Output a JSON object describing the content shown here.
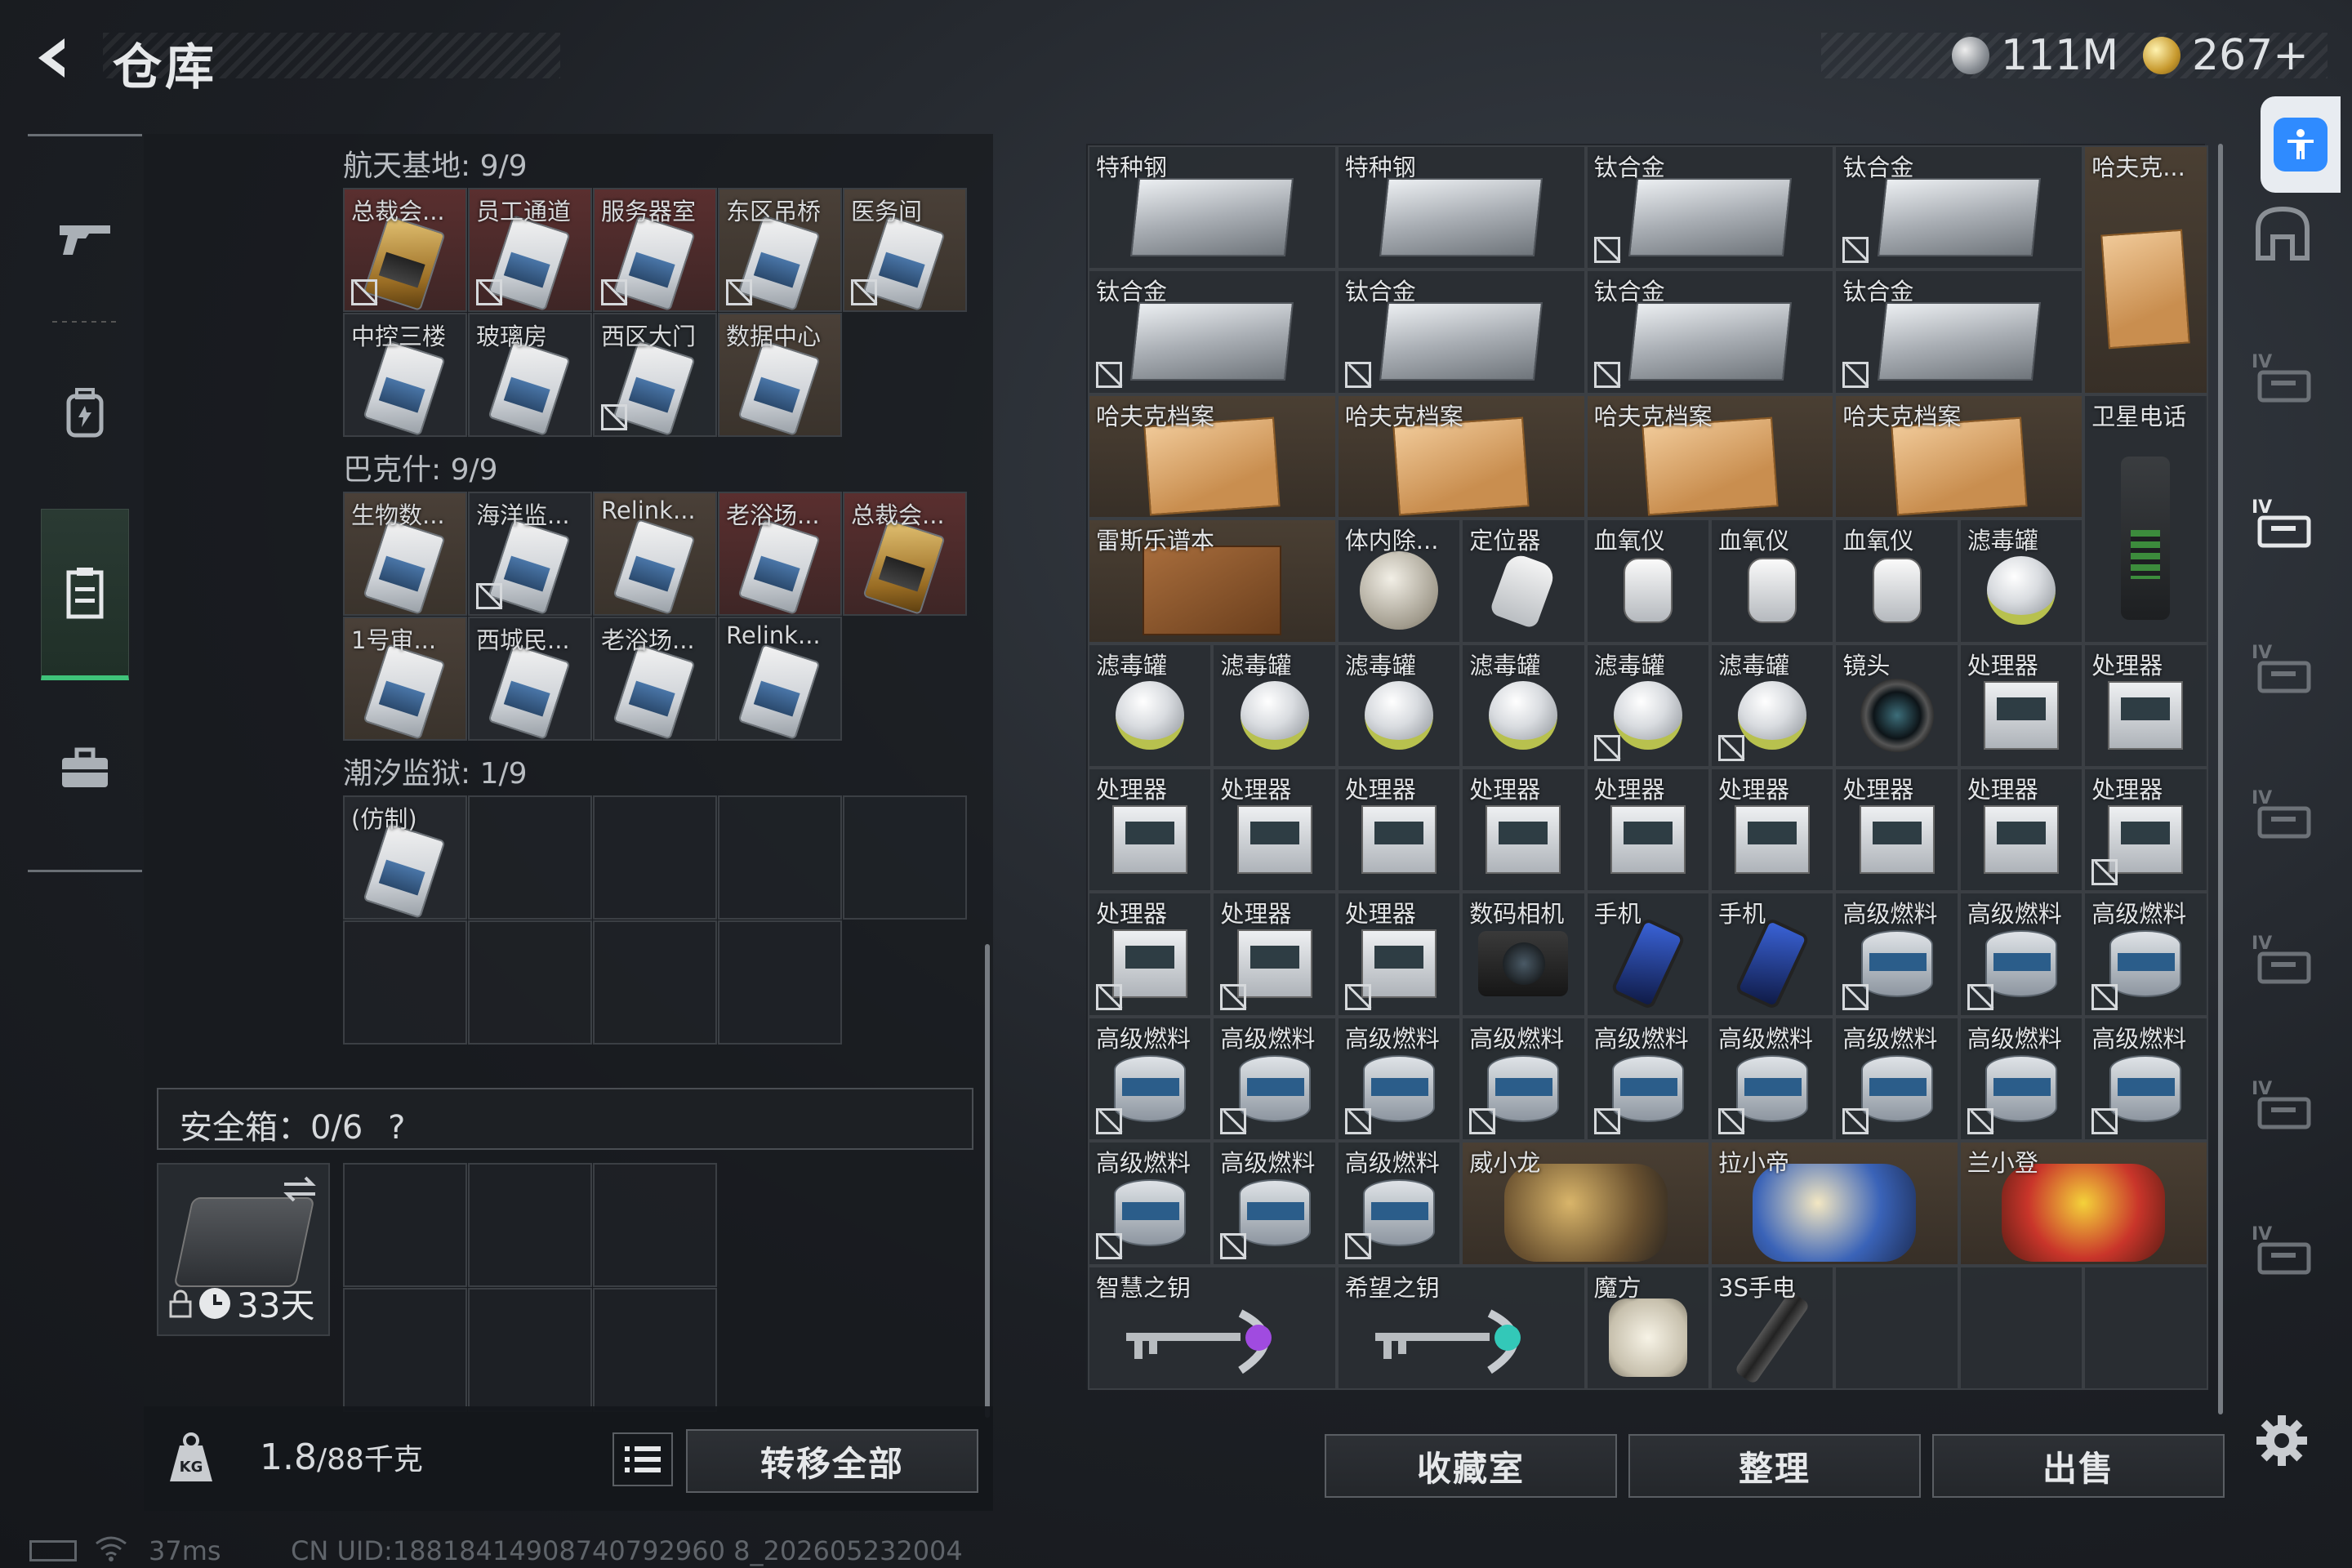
{
  "header": {
    "title": "仓库",
    "currency": [
      {
        "icon": "silver-coin-icon",
        "value": "111M"
      },
      {
        "icon": "gold-coin-icon",
        "value": "267+"
      }
    ]
  },
  "left_nav": [
    "gun-icon",
    "backpack-icon",
    "storage-icon",
    "briefcase-icon"
  ],
  "stash": {
    "sections": [
      {
        "label": "航天基地: 9/9",
        "items": [
          {
            "name": "总裁会...",
            "style": "gold",
            "bg": "red",
            "nolock": true
          },
          {
            "name": "员工通道",
            "style": "white",
            "bg": "red",
            "nolock": true
          },
          {
            "name": "服务器室",
            "style": "white",
            "bg": "red",
            "nolock": true
          },
          {
            "name": "东区吊桥",
            "style": "white",
            "bg": "brown",
            "nolock": true
          },
          {
            "name": "医务间",
            "style": "white",
            "bg": "brown",
            "nolock": true
          },
          {
            "name": "中控三楼",
            "style": "white",
            "bg": "grey",
            "nolock": false
          },
          {
            "name": "玻璃房",
            "style": "white",
            "bg": "grey",
            "nolock": false
          },
          {
            "name": "西区大门",
            "style": "white",
            "bg": "grey",
            "nolock": true
          },
          {
            "name": "数据中心",
            "style": "white",
            "bg": "brown",
            "nolock": false
          }
        ]
      },
      {
        "label": "巴克什: 9/9",
        "items": [
          {
            "name": "生物数...",
            "style": "white",
            "bg": "brown",
            "nolock": false
          },
          {
            "name": "海洋监...",
            "style": "white",
            "bg": "grey",
            "nolock": true
          },
          {
            "name": "Relink...",
            "style": "white",
            "bg": "brown",
            "nolock": false
          },
          {
            "name": "老浴场...",
            "style": "white",
            "bg": "red",
            "nolock": false
          },
          {
            "name": "总裁会...",
            "style": "gold",
            "bg": "red",
            "nolock": false
          },
          {
            "name": "1号审...",
            "style": "white",
            "bg": "brown",
            "nolock": false
          },
          {
            "name": "西城民...",
            "style": "white",
            "bg": "grey",
            "nolock": false
          },
          {
            "name": "老浴场...",
            "style": "white",
            "bg": "grey",
            "nolock": false
          },
          {
            "name": "Relink...",
            "style": "white",
            "bg": "grey",
            "nolock": false
          }
        ]
      },
      {
        "label": "潮汐监狱: 1/9",
        "items": [
          {
            "name": "(仿制)",
            "style": "white",
            "bg": "grey",
            "nolock": false
          }
        ]
      }
    ],
    "safe_box": {
      "label": "安全箱：0/6",
      "help": "?"
    },
    "case_timer": "33天",
    "weight": {
      "current": "1.8",
      "max": "/88千克"
    },
    "transfer_all": "转移全部"
  },
  "inventory": {
    "items": [
      {
        "name": "特种钢",
        "art": "plate",
        "c": 0,
        "r": 0,
        "w": 2,
        "h": 1,
        "nolock": false
      },
      {
        "name": "特种钢",
        "art": "plate",
        "c": 2,
        "r": 0,
        "w": 2,
        "h": 1,
        "nolock": false
      },
      {
        "name": "钛合金",
        "art": "plate",
        "c": 4,
        "r": 0,
        "w": 2,
        "h": 1,
        "nolock": true
      },
      {
        "name": "钛合金",
        "art": "plate",
        "c": 6,
        "r": 0,
        "w": 2,
        "h": 1,
        "nolock": true
      },
      {
        "name": "哈夫克...",
        "art": "folder-tall",
        "c": 8,
        "r": 0,
        "w": 1,
        "h": 2,
        "nolock": false
      },
      {
        "name": "钛合金",
        "art": "plate",
        "c": 0,
        "r": 1,
        "w": 2,
        "h": 1,
        "nolock": true
      },
      {
        "name": "钛合金",
        "art": "plate",
        "c": 2,
        "r": 1,
        "w": 2,
        "h": 1,
        "nolock": true
      },
      {
        "name": "钛合金",
        "art": "plate",
        "c": 4,
        "r": 1,
        "w": 2,
        "h": 1,
        "nolock": true
      },
      {
        "name": "钛合金",
        "art": "plate",
        "c": 6,
        "r": 1,
        "w": 2,
        "h": 1,
        "nolock": true
      },
      {
        "name": "哈夫克档案",
        "art": "folder",
        "c": 0,
        "r": 2,
        "w": 2,
        "h": 1,
        "nolock": false
      },
      {
        "name": "哈夫克档案",
        "art": "folder",
        "c": 2,
        "r": 2,
        "w": 2,
        "h": 1,
        "nolock": false
      },
      {
        "name": "哈夫克档案",
        "art": "folder",
        "c": 4,
        "r": 2,
        "w": 2,
        "h": 1,
        "nolock": false
      },
      {
        "name": "哈夫克档案",
        "art": "folder",
        "c": 6,
        "r": 2,
        "w": 2,
        "h": 1,
        "nolock": false
      },
      {
        "name": "卫星电话",
        "art": "satphone",
        "c": 8,
        "r": 2,
        "w": 1,
        "h": 2,
        "nolock": false
      },
      {
        "name": "雷斯乐谱本",
        "art": "notebook",
        "c": 0,
        "r": 3,
        "w": 2,
        "h": 1,
        "nolock": false
      },
      {
        "name": "体内除...",
        "art": "disc",
        "c": 2,
        "r": 3,
        "w": 1,
        "h": 1,
        "nolock": false
      },
      {
        "name": "定位器",
        "art": "locator",
        "c": 3,
        "r": 3,
        "w": 1,
        "h": 1,
        "nolock": false
      },
      {
        "name": "血氧仪",
        "art": "o2",
        "c": 4,
        "r": 3,
        "w": 1,
        "h": 1,
        "nolock": false
      },
      {
        "name": "血氧仪",
        "art": "o2",
        "c": 5,
        "r": 3,
        "w": 1,
        "h": 1,
        "nolock": false
      },
      {
        "name": "血氧仪",
        "art": "o2",
        "c": 6,
        "r": 3,
        "w": 1,
        "h": 1,
        "nolock": false
      },
      {
        "name": "滤毒罐",
        "art": "canister",
        "c": 7,
        "r": 3,
        "w": 1,
        "h": 1,
        "nolock": false
      },
      {
        "name": "滤毒罐",
        "art": "canister",
        "c": 0,
        "r": 4,
        "w": 1,
        "h": 1,
        "nolock": false
      },
      {
        "name": "滤毒罐",
        "art": "canister",
        "c": 1,
        "r": 4,
        "w": 1,
        "h": 1,
        "nolock": false
      },
      {
        "name": "滤毒罐",
        "art": "canister",
        "c": 2,
        "r": 4,
        "w": 1,
        "h": 1,
        "nolock": false
      },
      {
        "name": "滤毒罐",
        "art": "canister",
        "c": 3,
        "r": 4,
        "w": 1,
        "h": 1,
        "nolock": false
      },
      {
        "name": "滤毒罐",
        "art": "canister",
        "c": 4,
        "r": 4,
        "w": 1,
        "h": 1,
        "nolock": true
      },
      {
        "name": "滤毒罐",
        "art": "canister",
        "c": 5,
        "r": 4,
        "w": 1,
        "h": 1,
        "nolock": true
      },
      {
        "name": "镜头",
        "art": "lens",
        "c": 6,
        "r": 4,
        "w": 1,
        "h": 1,
        "nolock": false
      },
      {
        "name": "处理器",
        "art": "processor",
        "c": 7,
        "r": 4,
        "w": 1,
        "h": 1,
        "nolock": false
      },
      {
        "name": "处理器",
        "art": "processor",
        "c": 8,
        "r": 4,
        "w": 1,
        "h": 1,
        "nolock": false
      },
      {
        "name": "处理器",
        "art": "processor",
        "c": 0,
        "r": 5,
        "w": 1,
        "h": 1,
        "nolock": false
      },
      {
        "name": "处理器",
        "art": "processor",
        "c": 1,
        "r": 5,
        "w": 1,
        "h": 1,
        "nolock": false
      },
      {
        "name": "处理器",
        "art": "processor",
        "c": 2,
        "r": 5,
        "w": 1,
        "h": 1,
        "nolock": false
      },
      {
        "name": "处理器",
        "art": "processor",
        "c": 3,
        "r": 5,
        "w": 1,
        "h": 1,
        "nolock": false
      },
      {
        "name": "处理器",
        "art": "processor",
        "c": 4,
        "r": 5,
        "w": 1,
        "h": 1,
        "nolock": false
      },
      {
        "name": "处理器",
        "art": "processor",
        "c": 5,
        "r": 5,
        "w": 1,
        "h": 1,
        "nolock": false
      },
      {
        "name": "处理器",
        "art": "processor",
        "c": 6,
        "r": 5,
        "w": 1,
        "h": 1,
        "nolock": false
      },
      {
        "name": "处理器",
        "art": "processor",
        "c": 7,
        "r": 5,
        "w": 1,
        "h": 1,
        "nolock": false
      },
      {
        "name": "处理器",
        "art": "processor",
        "c": 8,
        "r": 5,
        "w": 1,
        "h": 1,
        "nolock": true
      },
      {
        "name": "处理器",
        "art": "processor",
        "c": 0,
        "r": 6,
        "w": 1,
        "h": 1,
        "nolock": true
      },
      {
        "name": "处理器",
        "art": "processor",
        "c": 1,
        "r": 6,
        "w": 1,
        "h": 1,
        "nolock": true
      },
      {
        "name": "处理器",
        "art": "processor",
        "c": 2,
        "r": 6,
        "w": 1,
        "h": 1,
        "nolock": true
      },
      {
        "name": "数码相机",
        "art": "camera",
        "c": 3,
        "r": 6,
        "w": 1,
        "h": 1,
        "nolock": false
      },
      {
        "name": "手机",
        "art": "phone",
        "c": 4,
        "r": 6,
        "w": 1,
        "h": 1,
        "nolock": false
      },
      {
        "name": "手机",
        "art": "phone",
        "c": 5,
        "r": 6,
        "w": 1,
        "h": 1,
        "nolock": false
      },
      {
        "name": "高级燃料",
        "art": "fuel",
        "c": 6,
        "r": 6,
        "w": 1,
        "h": 1,
        "nolock": true
      },
      {
        "name": "高级燃料",
        "art": "fuel",
        "c": 7,
        "r": 6,
        "w": 1,
        "h": 1,
        "nolock": true
      },
      {
        "name": "高级燃料",
        "art": "fuel",
        "c": 8,
        "r": 6,
        "w": 1,
        "h": 1,
        "nolock": true
      },
      {
        "name": "高级燃料",
        "art": "fuel",
        "c": 0,
        "r": 7,
        "w": 1,
        "h": 1,
        "nolock": true
      },
      {
        "name": "高级燃料",
        "art": "fuel",
        "c": 1,
        "r": 7,
        "w": 1,
        "h": 1,
        "nolock": true
      },
      {
        "name": "高级燃料",
        "art": "fuel",
        "c": 2,
        "r": 7,
        "w": 1,
        "h": 1,
        "nolock": true
      },
      {
        "name": "高级燃料",
        "art": "fuel",
        "c": 3,
        "r": 7,
        "w": 1,
        "h": 1,
        "nolock": true
      },
      {
        "name": "高级燃料",
        "art": "fuel",
        "c": 4,
        "r": 7,
        "w": 1,
        "h": 1,
        "nolock": true
      },
      {
        "name": "高级燃料",
        "art": "fuel",
        "c": 5,
        "r": 7,
        "w": 1,
        "h": 1,
        "nolock": true
      },
      {
        "name": "高级燃料",
        "art": "fuel",
        "c": 6,
        "r": 7,
        "w": 1,
        "h": 1,
        "nolock": true
      },
      {
        "name": "高级燃料",
        "art": "fuel",
        "c": 7,
        "r": 7,
        "w": 1,
        "h": 1,
        "nolock": true
      },
      {
        "name": "高级燃料",
        "art": "fuel",
        "c": 8,
        "r": 7,
        "w": 1,
        "h": 1,
        "nolock": true
      },
      {
        "name": "高级燃料",
        "art": "fuel",
        "c": 0,
        "r": 8,
        "w": 1,
        "h": 1,
        "nolock": true
      },
      {
        "name": "高级燃料",
        "art": "fuel",
        "c": 1,
        "r": 8,
        "w": 1,
        "h": 1,
        "nolock": true
      },
      {
        "name": "高级燃料",
        "art": "fuel",
        "c": 2,
        "r": 8,
        "w": 1,
        "h": 1,
        "nolock": true
      },
      {
        "name": "威小龙",
        "art": "toy-dragon",
        "c": 3,
        "r": 8,
        "w": 2,
        "h": 1,
        "nolock": false
      },
      {
        "name": "拉小帝",
        "art": "toy-blue",
        "c": 5,
        "r": 8,
        "w": 2,
        "h": 1,
        "nolock": false
      },
      {
        "name": "兰小登",
        "art": "toy-red",
        "c": 7,
        "r": 8,
        "w": 2,
        "h": 1,
        "nolock": false
      },
      {
        "name": "智慧之钥",
        "art": "key-purple",
        "c": 0,
        "r": 9,
        "w": 2,
        "h": 1,
        "nolock": false
      },
      {
        "name": "希望之钥",
        "art": "key-teal",
        "c": 2,
        "r": 9,
        "w": 2,
        "h": 1,
        "nolock": false
      },
      {
        "name": "魔方",
        "art": "cube",
        "c": 4,
        "r": 9,
        "w": 1,
        "h": 1,
        "nolock": false
      },
      {
        "name": "3S手电",
        "art": "flashlight",
        "c": 5,
        "r": 9,
        "w": 1,
        "h": 1,
        "nolock": false
      }
    ],
    "buttons": {
      "collection": "收藏室",
      "organize": "整理",
      "sell": "出售"
    }
  },
  "side_nav": [
    "home-icon",
    "tier4-weapon-icon",
    "tier4-gear-icon",
    "tier4-camera-icon",
    "tier4-folder-icon",
    "tier4-medkit-icon",
    "tier4-warning-icon",
    "tier4-triangle-icon"
  ],
  "status": {
    "ping": "37ms",
    "uid": "CN UID:18818414908740792960 8_202605232004"
  },
  "colors": {
    "accent_green": "#3fc37a",
    "accessibility_blue": "#2f8bff"
  }
}
